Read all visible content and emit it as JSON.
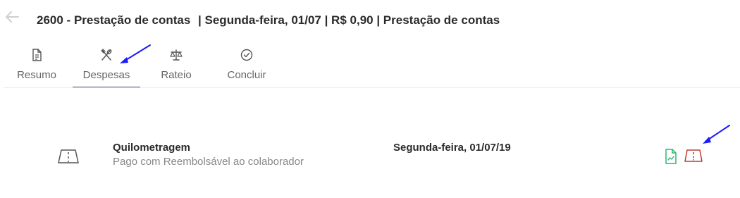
{
  "header": {
    "code": "2600 -",
    "title": "Prestação de contas",
    "details": "| Segunda-feira, 01/07 | R$ 0,90 | Prestação de contas"
  },
  "tabs": [
    {
      "label": "Resumo",
      "icon": "document-icon",
      "active": false
    },
    {
      "label": "Despesas",
      "icon": "utensils-icon",
      "active": true
    },
    {
      "label": "Rateio",
      "icon": "scale-icon",
      "active": false
    },
    {
      "label": "Concluir",
      "icon": "check-circle-icon",
      "active": false
    }
  ],
  "expense": {
    "icon": "road-icon",
    "title": "Quilometragem",
    "subtitle": "Pago com Reembolsável ao colaborador",
    "date": "Segunda-feira, 01/07/19",
    "actions": [
      {
        "icon": "receipt-icon",
        "color": "#2bb673"
      },
      {
        "icon": "road-warning-icon",
        "color": "#c0392b"
      }
    ]
  },
  "colors": {
    "accent": "#4a4f73",
    "annotation": "#1a1aff"
  }
}
